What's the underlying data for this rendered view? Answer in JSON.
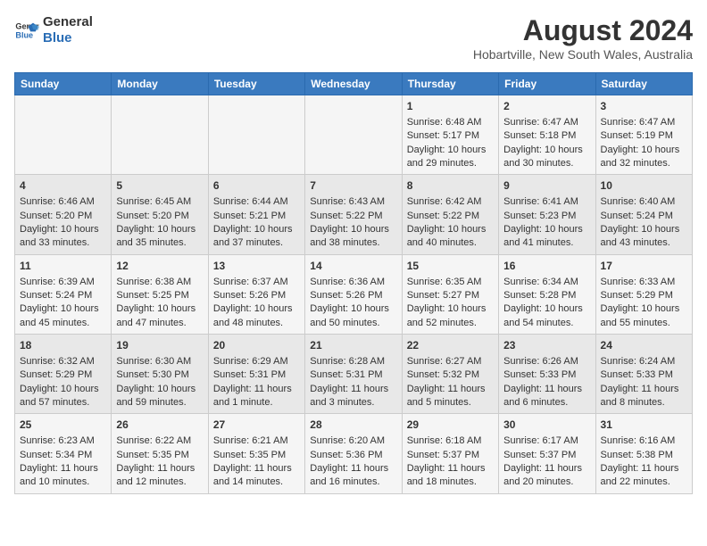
{
  "logo": {
    "line1": "General",
    "line2": "Blue"
  },
  "title": "August 2024",
  "subtitle": "Hobartville, New South Wales, Australia",
  "days_of_week": [
    "Sunday",
    "Monday",
    "Tuesday",
    "Wednesday",
    "Thursday",
    "Friday",
    "Saturday"
  ],
  "weeks": [
    [
      {
        "day": "",
        "info": ""
      },
      {
        "day": "",
        "info": ""
      },
      {
        "day": "",
        "info": ""
      },
      {
        "day": "",
        "info": ""
      },
      {
        "day": "1",
        "info": "Sunrise: 6:48 AM\nSunset: 5:17 PM\nDaylight: 10 hours\nand 29 minutes."
      },
      {
        "day": "2",
        "info": "Sunrise: 6:47 AM\nSunset: 5:18 PM\nDaylight: 10 hours\nand 30 minutes."
      },
      {
        "day": "3",
        "info": "Sunrise: 6:47 AM\nSunset: 5:19 PM\nDaylight: 10 hours\nand 32 minutes."
      }
    ],
    [
      {
        "day": "4",
        "info": "Sunrise: 6:46 AM\nSunset: 5:20 PM\nDaylight: 10 hours\nand 33 minutes."
      },
      {
        "day": "5",
        "info": "Sunrise: 6:45 AM\nSunset: 5:20 PM\nDaylight: 10 hours\nand 35 minutes."
      },
      {
        "day": "6",
        "info": "Sunrise: 6:44 AM\nSunset: 5:21 PM\nDaylight: 10 hours\nand 37 minutes."
      },
      {
        "day": "7",
        "info": "Sunrise: 6:43 AM\nSunset: 5:22 PM\nDaylight: 10 hours\nand 38 minutes."
      },
      {
        "day": "8",
        "info": "Sunrise: 6:42 AM\nSunset: 5:22 PM\nDaylight: 10 hours\nand 40 minutes."
      },
      {
        "day": "9",
        "info": "Sunrise: 6:41 AM\nSunset: 5:23 PM\nDaylight: 10 hours\nand 41 minutes."
      },
      {
        "day": "10",
        "info": "Sunrise: 6:40 AM\nSunset: 5:24 PM\nDaylight: 10 hours\nand 43 minutes."
      }
    ],
    [
      {
        "day": "11",
        "info": "Sunrise: 6:39 AM\nSunset: 5:24 PM\nDaylight: 10 hours\nand 45 minutes."
      },
      {
        "day": "12",
        "info": "Sunrise: 6:38 AM\nSunset: 5:25 PM\nDaylight: 10 hours\nand 47 minutes."
      },
      {
        "day": "13",
        "info": "Sunrise: 6:37 AM\nSunset: 5:26 PM\nDaylight: 10 hours\nand 48 minutes."
      },
      {
        "day": "14",
        "info": "Sunrise: 6:36 AM\nSunset: 5:26 PM\nDaylight: 10 hours\nand 50 minutes."
      },
      {
        "day": "15",
        "info": "Sunrise: 6:35 AM\nSunset: 5:27 PM\nDaylight: 10 hours\nand 52 minutes."
      },
      {
        "day": "16",
        "info": "Sunrise: 6:34 AM\nSunset: 5:28 PM\nDaylight: 10 hours\nand 54 minutes."
      },
      {
        "day": "17",
        "info": "Sunrise: 6:33 AM\nSunset: 5:29 PM\nDaylight: 10 hours\nand 55 minutes."
      }
    ],
    [
      {
        "day": "18",
        "info": "Sunrise: 6:32 AM\nSunset: 5:29 PM\nDaylight: 10 hours\nand 57 minutes."
      },
      {
        "day": "19",
        "info": "Sunrise: 6:30 AM\nSunset: 5:30 PM\nDaylight: 10 hours\nand 59 minutes."
      },
      {
        "day": "20",
        "info": "Sunrise: 6:29 AM\nSunset: 5:31 PM\nDaylight: 11 hours\nand 1 minute."
      },
      {
        "day": "21",
        "info": "Sunrise: 6:28 AM\nSunset: 5:31 PM\nDaylight: 11 hours\nand 3 minutes."
      },
      {
        "day": "22",
        "info": "Sunrise: 6:27 AM\nSunset: 5:32 PM\nDaylight: 11 hours\nand 5 minutes."
      },
      {
        "day": "23",
        "info": "Sunrise: 6:26 AM\nSunset: 5:33 PM\nDaylight: 11 hours\nand 6 minutes."
      },
      {
        "day": "24",
        "info": "Sunrise: 6:24 AM\nSunset: 5:33 PM\nDaylight: 11 hours\nand 8 minutes."
      }
    ],
    [
      {
        "day": "25",
        "info": "Sunrise: 6:23 AM\nSunset: 5:34 PM\nDaylight: 11 hours\nand 10 minutes."
      },
      {
        "day": "26",
        "info": "Sunrise: 6:22 AM\nSunset: 5:35 PM\nDaylight: 11 hours\nand 12 minutes."
      },
      {
        "day": "27",
        "info": "Sunrise: 6:21 AM\nSunset: 5:35 PM\nDaylight: 11 hours\nand 14 minutes."
      },
      {
        "day": "28",
        "info": "Sunrise: 6:20 AM\nSunset: 5:36 PM\nDaylight: 11 hours\nand 16 minutes."
      },
      {
        "day": "29",
        "info": "Sunrise: 6:18 AM\nSunset: 5:37 PM\nDaylight: 11 hours\nand 18 minutes."
      },
      {
        "day": "30",
        "info": "Sunrise: 6:17 AM\nSunset: 5:37 PM\nDaylight: 11 hours\nand 20 minutes."
      },
      {
        "day": "31",
        "info": "Sunrise: 6:16 AM\nSunset: 5:38 PM\nDaylight: 11 hours\nand 22 minutes."
      }
    ]
  ]
}
